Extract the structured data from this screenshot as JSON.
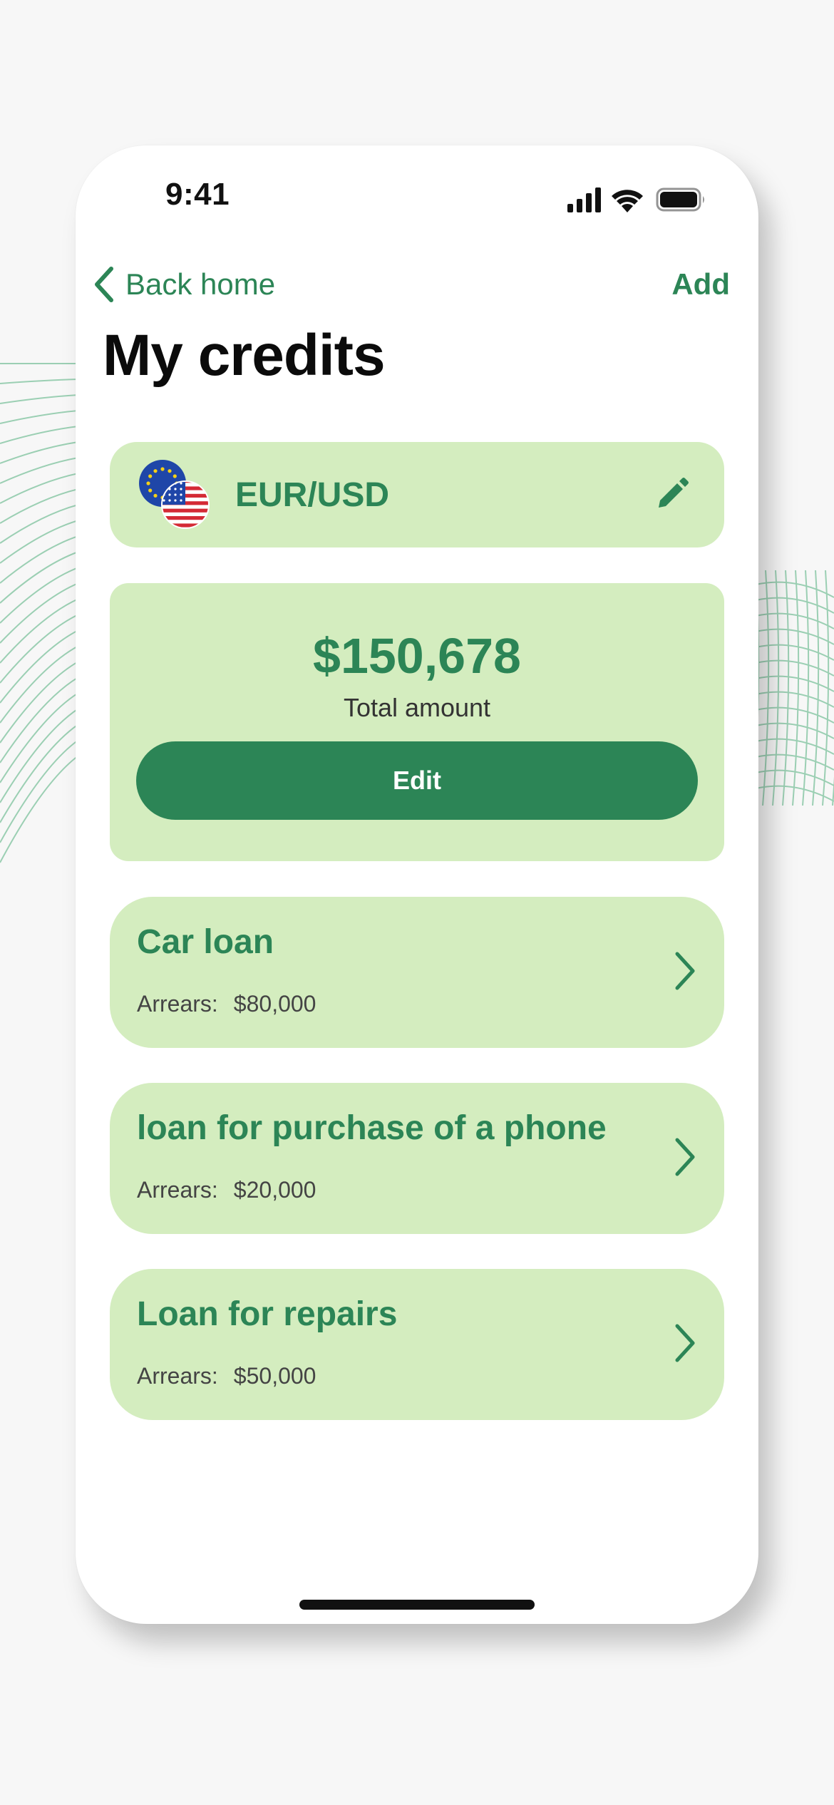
{
  "status_bar": {
    "time": "9:41",
    "icons": [
      "cellular-signal-icon",
      "wifi-icon",
      "battery-icon"
    ]
  },
  "nav": {
    "back_label": "Back home",
    "add_label": "Add"
  },
  "page": {
    "title": "My credits"
  },
  "currency": {
    "pair": "EUR/USD",
    "flag_icons": [
      "eu-flag-icon",
      "us-flag-icon"
    ],
    "edit_icon": "pencil-icon"
  },
  "summary": {
    "amount": "$150,678",
    "label": "Total amount",
    "edit_button": "Edit"
  },
  "loans": [
    {
      "title": "Car loan",
      "arrears_label": "Arrears:",
      "arrears_value": "$80,000"
    },
    {
      "title": "loan for purchase of a phone",
      "arrears_label": "Arrears:",
      "arrears_value": "$20,000"
    },
    {
      "title": "Loan for repairs",
      "arrears_label": "Arrears:",
      "arrears_value": "$50,000"
    }
  ],
  "colors": {
    "accent": "#2c8556",
    "card_background": "#d4edbf",
    "title_text": "#0b0b0b"
  }
}
